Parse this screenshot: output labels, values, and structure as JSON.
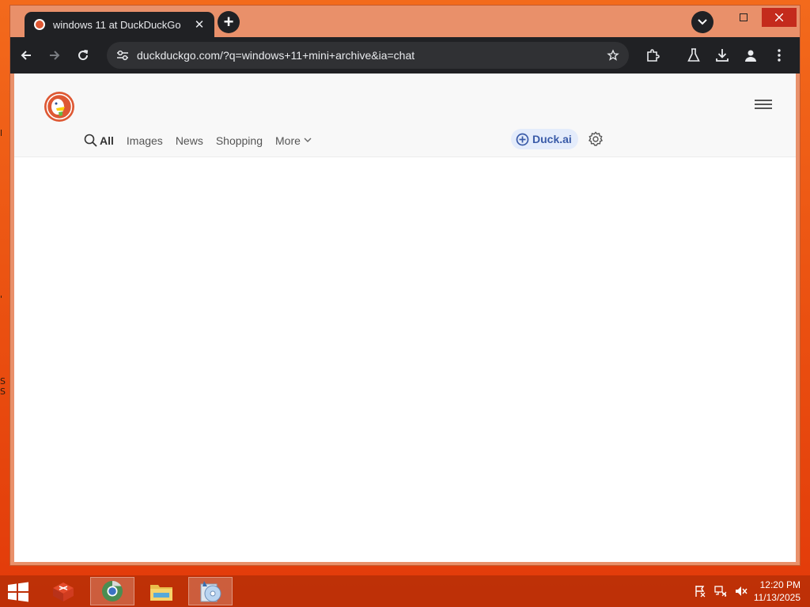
{
  "browser": {
    "tab_title": "windows 11 at DuckDuckGo",
    "url": "duckduckgo.com/?q=windows+11+mini+archive&ia=chat"
  },
  "search_nav": {
    "all_label": "All",
    "images_label": "Images",
    "news_label": "News",
    "shopping_label": "Shopping",
    "more_label": "More",
    "duckai_label": "Duck.ai"
  },
  "taskbar": {
    "time": "12:20 PM",
    "date": "11/13/2025"
  },
  "colors": {
    "desktop": "#f36a1c",
    "window_frame": "#e9906a",
    "browser_chrome": "#202124",
    "ddg_accent": "#de5833",
    "duckai_bg": "#e4ecfb"
  }
}
